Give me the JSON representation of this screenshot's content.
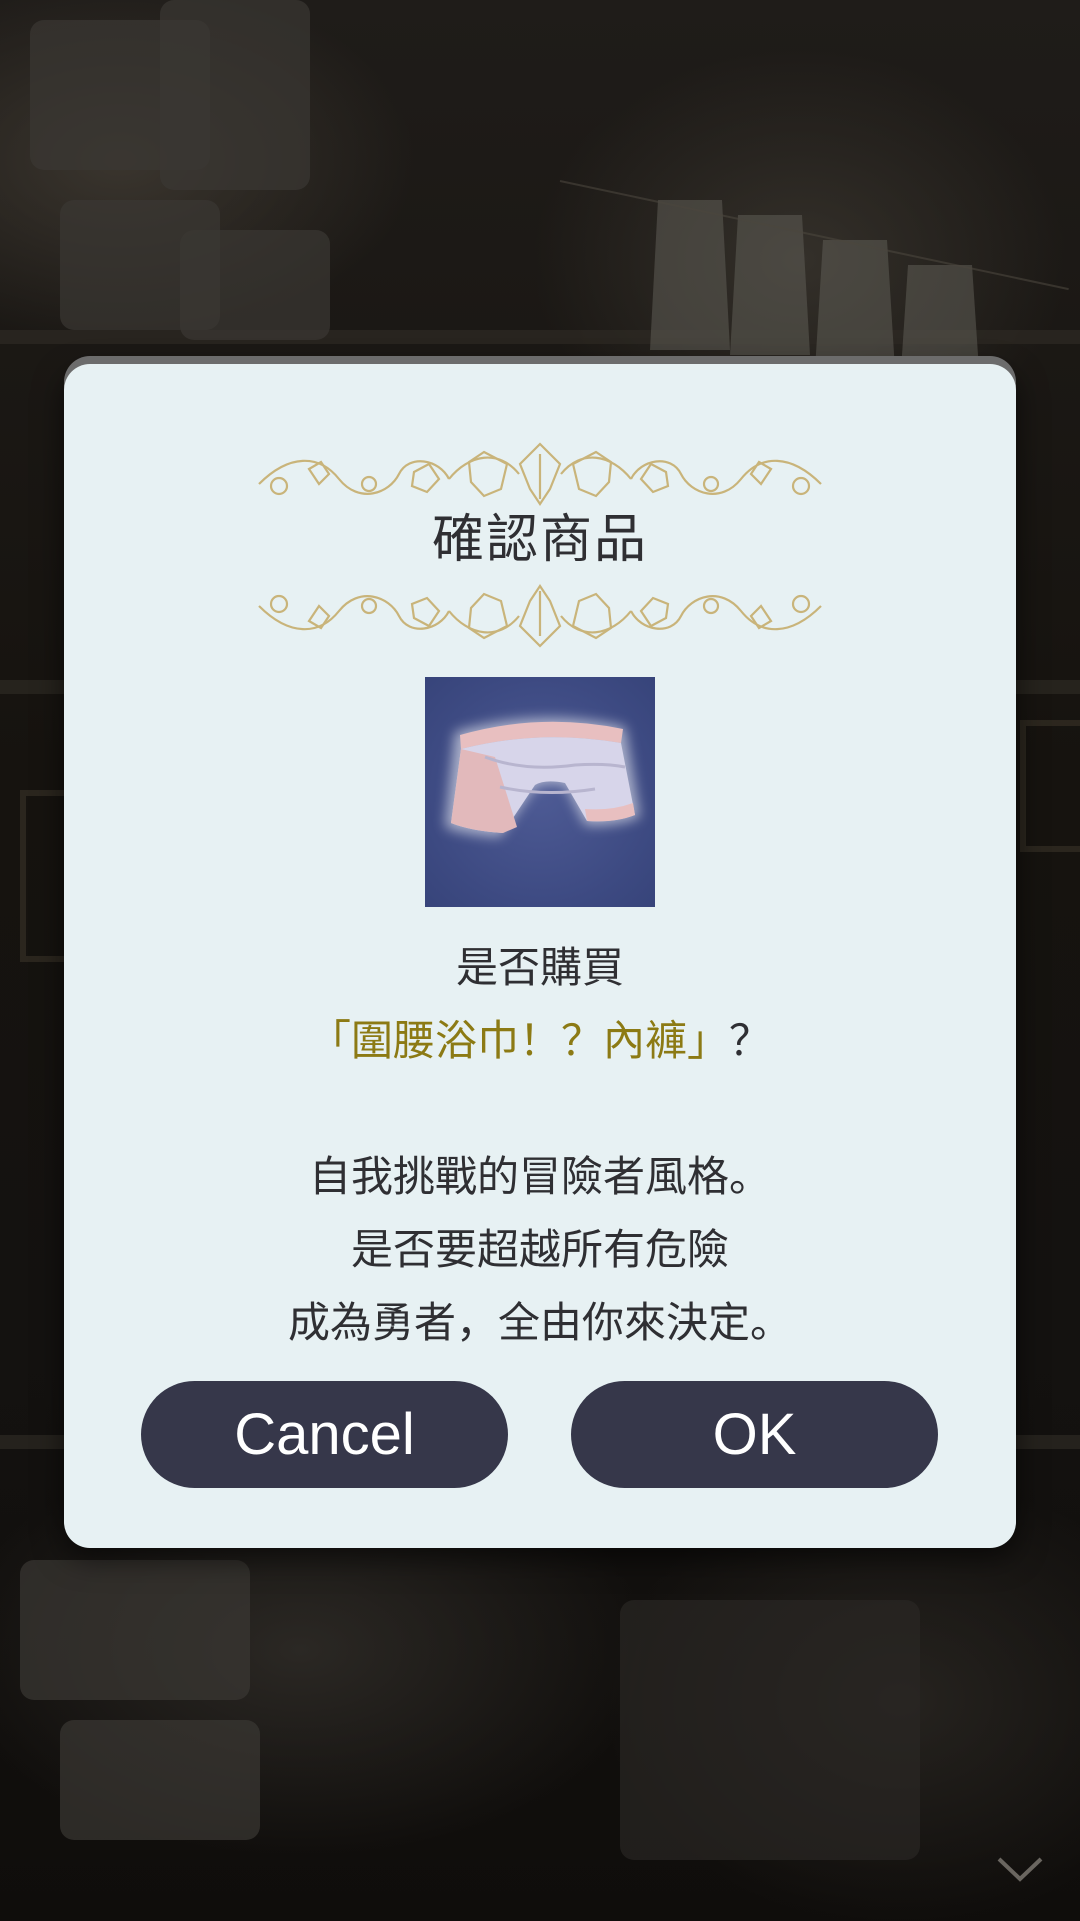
{
  "dialog": {
    "title": "確認商品",
    "question": "是否購買",
    "item_name": "「圍腰浴巾！？內褲」",
    "question_mark": "？",
    "description_lines": [
      "自我挑戰的冒險者風格。",
      "是否要超越所有危險",
      "成為勇者，全由你來決定。"
    ],
    "item_image_icon": "shorts-icon"
  },
  "buttons": {
    "cancel_label": "Cancel",
    "ok_label": "OK"
  },
  "colors": {
    "dialog_bg": "#e7f1f3",
    "button_bg": "#36374a",
    "item_name": "#8c7a14",
    "ornament": "#c9b47a"
  }
}
